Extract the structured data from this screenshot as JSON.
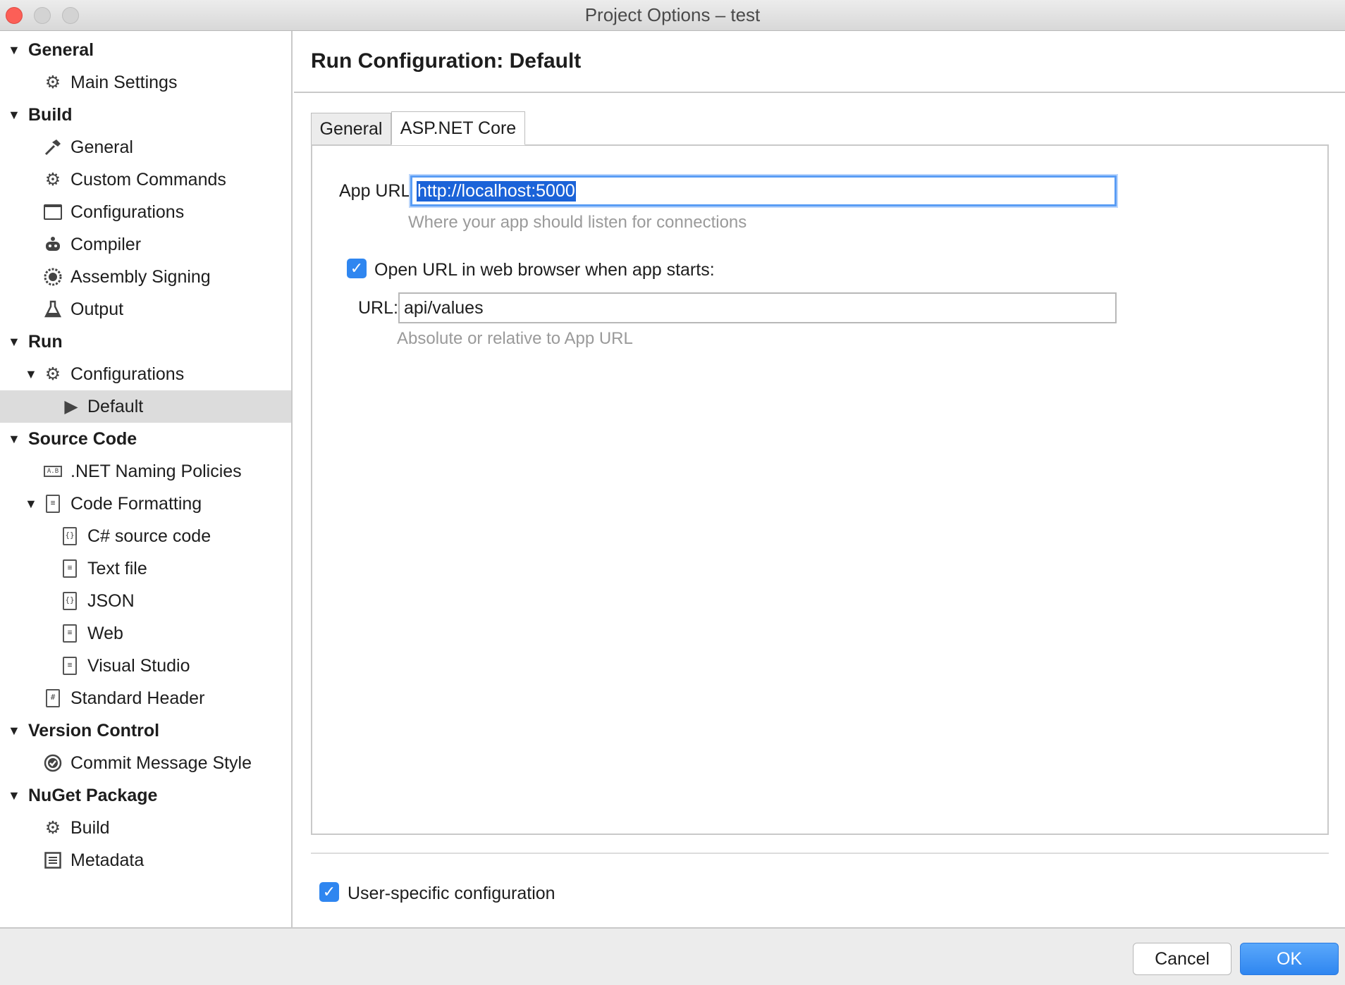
{
  "window": {
    "title": "Project Options – test"
  },
  "sidebar": {
    "items": [
      {
        "label": "General",
        "type": "section",
        "icon": "disclosure-triangle"
      },
      {
        "label": "Main Settings",
        "type": "item",
        "icon": "gear-icon"
      },
      {
        "label": "Build",
        "type": "section",
        "icon": "disclosure-triangle"
      },
      {
        "label": "General",
        "type": "item",
        "icon": "hammer-icon"
      },
      {
        "label": "Custom Commands",
        "type": "item",
        "icon": "gear-icon"
      },
      {
        "label": "Configurations",
        "type": "item",
        "icon": "window-icon"
      },
      {
        "label": "Compiler",
        "type": "item",
        "icon": "robot-icon"
      },
      {
        "label": "Assembly Signing",
        "type": "item",
        "icon": "seal-icon"
      },
      {
        "label": "Output",
        "type": "item",
        "icon": "flask-icon"
      },
      {
        "label": "Run",
        "type": "section",
        "icon": "disclosure-triangle"
      },
      {
        "label": "Configurations",
        "type": "item",
        "icon": "gear-icon"
      },
      {
        "label": "Default",
        "type": "item",
        "icon": "play-icon",
        "selected": true
      },
      {
        "label": "Source Code",
        "type": "section",
        "icon": "disclosure-triangle"
      },
      {
        "label": ".NET Naming Policies",
        "type": "item",
        "icon": "naming-icon"
      },
      {
        "label": "Code Formatting",
        "type": "item",
        "icon": "formatting-icon"
      },
      {
        "label": "C# source code",
        "type": "item",
        "icon": "braces-document-icon"
      },
      {
        "label": "Text file",
        "type": "item",
        "icon": "text-document-icon"
      },
      {
        "label": "JSON",
        "type": "item",
        "icon": "braces-document-icon"
      },
      {
        "label": "Web",
        "type": "item",
        "icon": "text-document-icon"
      },
      {
        "label": "Visual Studio",
        "type": "item",
        "icon": "text-document-icon"
      },
      {
        "label": "Standard Header",
        "type": "item",
        "icon": "hash-document-icon"
      },
      {
        "label": "Version Control",
        "type": "section",
        "icon": "disclosure-triangle"
      },
      {
        "label": "Commit Message Style",
        "type": "item",
        "icon": "check-circle-icon"
      },
      {
        "label": "NuGet Package",
        "type": "section",
        "icon": "disclosure-triangle"
      },
      {
        "label": "Build",
        "type": "item",
        "icon": "gear-icon"
      },
      {
        "label": "Metadata",
        "type": "item",
        "icon": "list-icon"
      }
    ]
  },
  "main": {
    "title": "Run Configuration: Default",
    "tabs": [
      {
        "label": "General",
        "active": false
      },
      {
        "label": "ASP.NET Core",
        "active": true
      }
    ],
    "app_url": {
      "label": "App URL:",
      "value": "http://localhost:5000",
      "hint": "Where your app should listen for connections"
    },
    "open_browser": {
      "label": "Open URL in web browser when app starts:",
      "checked": true
    },
    "url": {
      "label": "URL:",
      "value": "api/values",
      "hint": "Absolute or relative to App URL"
    },
    "user_specific": {
      "label": "User-specific configuration",
      "checked": true
    }
  },
  "footer": {
    "cancel_label": "Cancel",
    "ok_label": "OK"
  },
  "colors": {
    "accent": "#2f86f0",
    "selection": "#dcdcdc",
    "close": "#fc5f57"
  }
}
